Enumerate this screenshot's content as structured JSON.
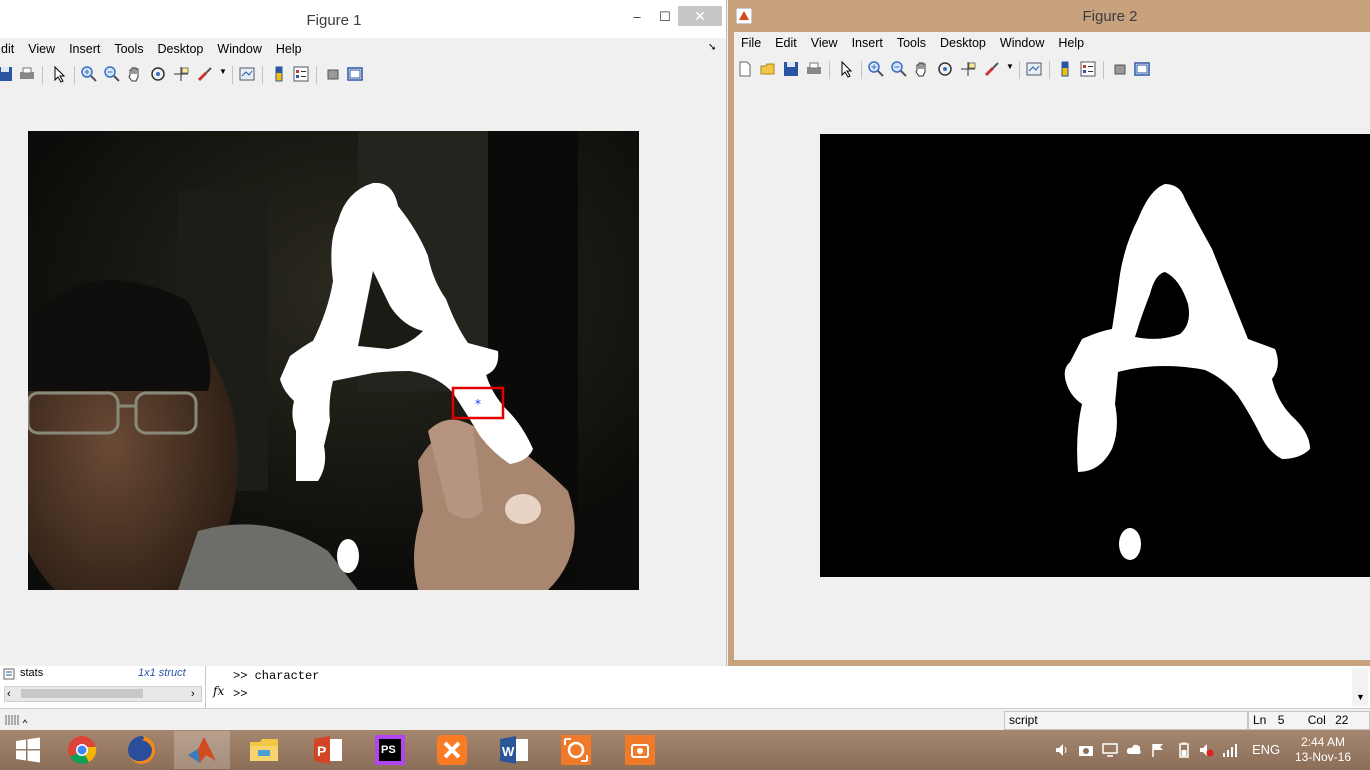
{
  "figure1": {
    "title": "Figure 1",
    "menu": [
      "dit",
      "View",
      "Insert",
      "Tools",
      "Desktop",
      "Window",
      "Help"
    ],
    "minimize": "–",
    "maximize": "☐",
    "close": "✕"
  },
  "figure2": {
    "title": "Figure 2",
    "menu": [
      "File",
      "Edit",
      "View",
      "Insert",
      "Tools",
      "Desktop",
      "Window",
      "Help"
    ]
  },
  "workspace": {
    "var_name": "stats",
    "var_value": "1x1 struct"
  },
  "command_window": {
    "line1": ">>  character",
    "line2": ">>",
    "fx_label": "fx"
  },
  "statusbar": {
    "script": "script",
    "ln_label": "Ln",
    "ln_value": "5",
    "col_label": "Col",
    "col_value": "22"
  },
  "taskbar": {
    "apps": [
      "start",
      "chrome",
      "firefox",
      "matlab",
      "file-explorer",
      "powerpoint",
      "phpstorm",
      "xampp",
      "word",
      "camera-app",
      "screenshot-app"
    ],
    "ps_label": "PS",
    "language": "ENG",
    "time": "2:44 AM",
    "date": "13-Nov-16"
  }
}
